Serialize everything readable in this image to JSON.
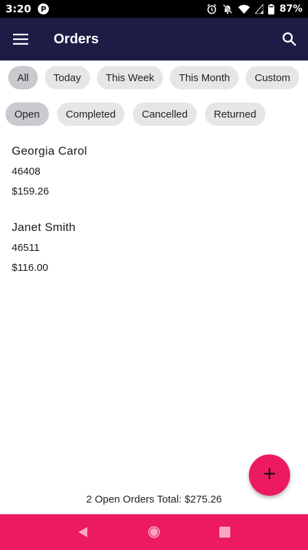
{
  "status_bar": {
    "time": "3:20",
    "notification_icon": "P",
    "battery": "87%",
    "icons": [
      "alarm-icon",
      "do-not-disturb-icon",
      "wifi-icon",
      "signal-icon",
      "battery-icon"
    ]
  },
  "app_bar": {
    "title": "Orders",
    "menu_icon": "hamburger-menu-icon",
    "search_icon": "search-icon",
    "background_color": "#1c1c44"
  },
  "date_filters": [
    {
      "label": "All",
      "selected": true
    },
    {
      "label": "Today",
      "selected": false
    },
    {
      "label": "This Week",
      "selected": false
    },
    {
      "label": "This Month",
      "selected": false
    },
    {
      "label": "Custom",
      "selected": false
    }
  ],
  "status_filters": [
    {
      "label": "Open",
      "selected": true
    },
    {
      "label": "Completed",
      "selected": false
    },
    {
      "label": "Cancelled",
      "selected": false
    },
    {
      "label": "Returned",
      "selected": false
    }
  ],
  "orders": [
    {
      "name": "Georgia Carol",
      "id": "46408",
      "total": "$159.26"
    },
    {
      "name": "Janet Smith",
      "id": "46511",
      "total": "$116.00"
    }
  ],
  "summary": "2 Open Orders Total: $275.26",
  "fab": {
    "icon": "plus-icon",
    "color": "#ec1a5e"
  },
  "nav_bar": {
    "color": "#ec1a5e",
    "buttons": [
      "back-icon",
      "home-icon",
      "recents-icon"
    ]
  }
}
